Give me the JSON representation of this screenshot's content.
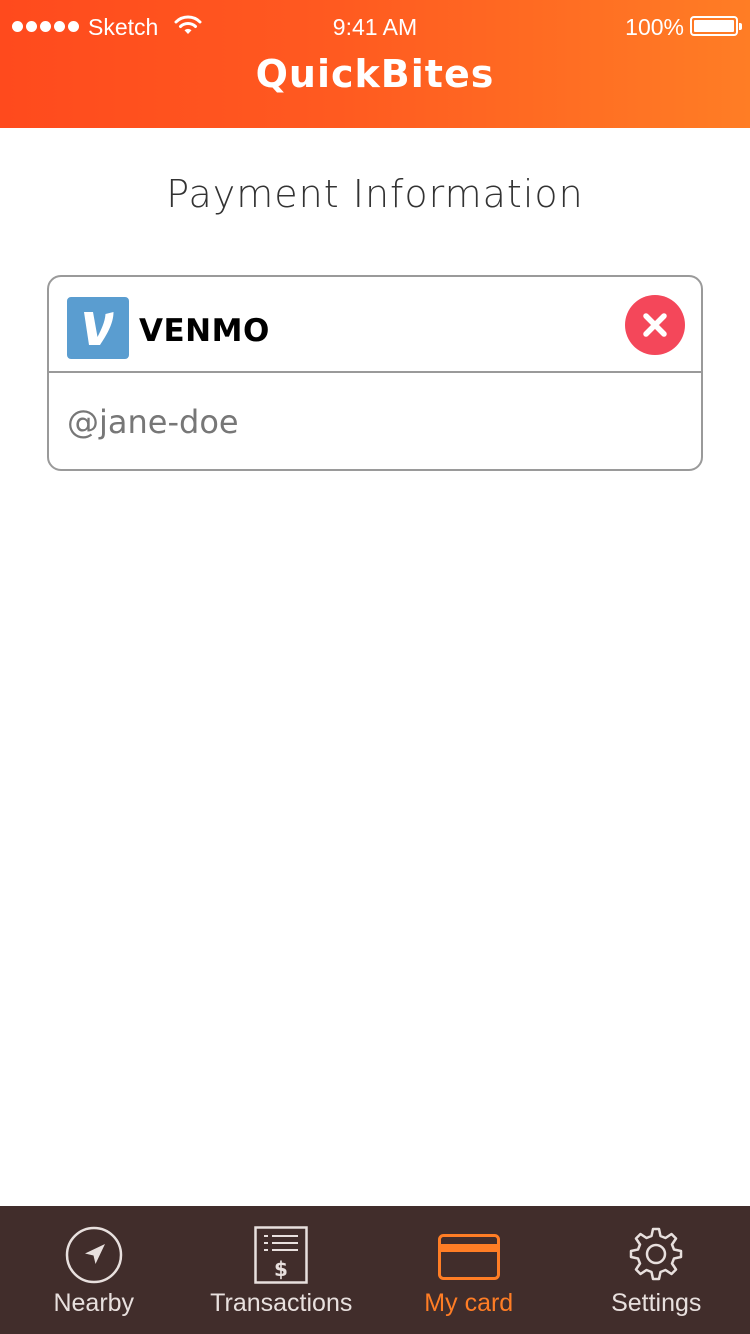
{
  "status_bar": {
    "carrier": "Sketch",
    "time": "9:41 AM",
    "battery": "100%"
  },
  "header": {
    "title": "QuickBites"
  },
  "page": {
    "title": "Payment Information"
  },
  "payment_method": {
    "provider": "VENMO",
    "logo_letter": "V",
    "handle_value": "@jane-doe",
    "icon": "venmo-logo"
  },
  "tabs": [
    {
      "label": "Nearby",
      "icon": "location-arrow-icon",
      "active": false
    },
    {
      "label": "Transactions",
      "icon": "receipt-icon",
      "active": false
    },
    {
      "label": "My card",
      "icon": "credit-card-icon",
      "active": true
    },
    {
      "label": "Settings",
      "icon": "gear-icon",
      "active": false
    }
  ],
  "colors": {
    "brand_start": "#ff4a1d",
    "brand_end": "#ff7d25",
    "tab_bar": "#412d2b",
    "active_tab": "#ff7d25",
    "remove": "#f4475a",
    "venmo_blue": "#5a9dd0"
  }
}
